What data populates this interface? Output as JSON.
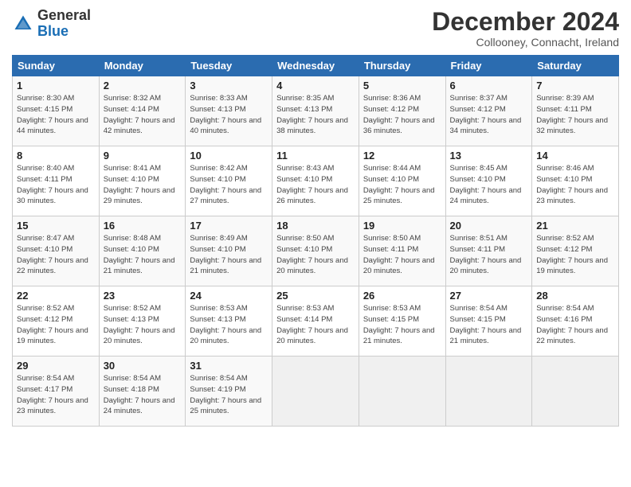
{
  "header": {
    "logo_general": "General",
    "logo_blue": "Blue",
    "month": "December 2024",
    "location": "Collooney, Connacht, Ireland"
  },
  "weekdays": [
    "Sunday",
    "Monday",
    "Tuesday",
    "Wednesday",
    "Thursday",
    "Friday",
    "Saturday"
  ],
  "weeks": [
    [
      {
        "day": "1",
        "sunrise": "Sunrise: 8:30 AM",
        "sunset": "Sunset: 4:15 PM",
        "daylight": "Daylight: 7 hours and 44 minutes."
      },
      {
        "day": "2",
        "sunrise": "Sunrise: 8:32 AM",
        "sunset": "Sunset: 4:14 PM",
        "daylight": "Daylight: 7 hours and 42 minutes."
      },
      {
        "day": "3",
        "sunrise": "Sunrise: 8:33 AM",
        "sunset": "Sunset: 4:13 PM",
        "daylight": "Daylight: 7 hours and 40 minutes."
      },
      {
        "day": "4",
        "sunrise": "Sunrise: 8:35 AM",
        "sunset": "Sunset: 4:13 PM",
        "daylight": "Daylight: 7 hours and 38 minutes."
      },
      {
        "day": "5",
        "sunrise": "Sunrise: 8:36 AM",
        "sunset": "Sunset: 4:12 PM",
        "daylight": "Daylight: 7 hours and 36 minutes."
      },
      {
        "day": "6",
        "sunrise": "Sunrise: 8:37 AM",
        "sunset": "Sunset: 4:12 PM",
        "daylight": "Daylight: 7 hours and 34 minutes."
      },
      {
        "day": "7",
        "sunrise": "Sunrise: 8:39 AM",
        "sunset": "Sunset: 4:11 PM",
        "daylight": "Daylight: 7 hours and 32 minutes."
      }
    ],
    [
      {
        "day": "8",
        "sunrise": "Sunrise: 8:40 AM",
        "sunset": "Sunset: 4:11 PM",
        "daylight": "Daylight: 7 hours and 30 minutes."
      },
      {
        "day": "9",
        "sunrise": "Sunrise: 8:41 AM",
        "sunset": "Sunset: 4:10 PM",
        "daylight": "Daylight: 7 hours and 29 minutes."
      },
      {
        "day": "10",
        "sunrise": "Sunrise: 8:42 AM",
        "sunset": "Sunset: 4:10 PM",
        "daylight": "Daylight: 7 hours and 27 minutes."
      },
      {
        "day": "11",
        "sunrise": "Sunrise: 8:43 AM",
        "sunset": "Sunset: 4:10 PM",
        "daylight": "Daylight: 7 hours and 26 minutes."
      },
      {
        "day": "12",
        "sunrise": "Sunrise: 8:44 AM",
        "sunset": "Sunset: 4:10 PM",
        "daylight": "Daylight: 7 hours and 25 minutes."
      },
      {
        "day": "13",
        "sunrise": "Sunrise: 8:45 AM",
        "sunset": "Sunset: 4:10 PM",
        "daylight": "Daylight: 7 hours and 24 minutes."
      },
      {
        "day": "14",
        "sunrise": "Sunrise: 8:46 AM",
        "sunset": "Sunset: 4:10 PM",
        "daylight": "Daylight: 7 hours and 23 minutes."
      }
    ],
    [
      {
        "day": "15",
        "sunrise": "Sunrise: 8:47 AM",
        "sunset": "Sunset: 4:10 PM",
        "daylight": "Daylight: 7 hours and 22 minutes."
      },
      {
        "day": "16",
        "sunrise": "Sunrise: 8:48 AM",
        "sunset": "Sunset: 4:10 PM",
        "daylight": "Daylight: 7 hours and 21 minutes."
      },
      {
        "day": "17",
        "sunrise": "Sunrise: 8:49 AM",
        "sunset": "Sunset: 4:10 PM",
        "daylight": "Daylight: 7 hours and 21 minutes."
      },
      {
        "day": "18",
        "sunrise": "Sunrise: 8:50 AM",
        "sunset": "Sunset: 4:10 PM",
        "daylight": "Daylight: 7 hours and 20 minutes."
      },
      {
        "day": "19",
        "sunrise": "Sunrise: 8:50 AM",
        "sunset": "Sunset: 4:11 PM",
        "daylight": "Daylight: 7 hours and 20 minutes."
      },
      {
        "day": "20",
        "sunrise": "Sunrise: 8:51 AM",
        "sunset": "Sunset: 4:11 PM",
        "daylight": "Daylight: 7 hours and 20 minutes."
      },
      {
        "day": "21",
        "sunrise": "Sunrise: 8:52 AM",
        "sunset": "Sunset: 4:12 PM",
        "daylight": "Daylight: 7 hours and 19 minutes."
      }
    ],
    [
      {
        "day": "22",
        "sunrise": "Sunrise: 8:52 AM",
        "sunset": "Sunset: 4:12 PM",
        "daylight": "Daylight: 7 hours and 19 minutes."
      },
      {
        "day": "23",
        "sunrise": "Sunrise: 8:52 AM",
        "sunset": "Sunset: 4:13 PM",
        "daylight": "Daylight: 7 hours and 20 minutes."
      },
      {
        "day": "24",
        "sunrise": "Sunrise: 8:53 AM",
        "sunset": "Sunset: 4:13 PM",
        "daylight": "Daylight: 7 hours and 20 minutes."
      },
      {
        "day": "25",
        "sunrise": "Sunrise: 8:53 AM",
        "sunset": "Sunset: 4:14 PM",
        "daylight": "Daylight: 7 hours and 20 minutes."
      },
      {
        "day": "26",
        "sunrise": "Sunrise: 8:53 AM",
        "sunset": "Sunset: 4:15 PM",
        "daylight": "Daylight: 7 hours and 21 minutes."
      },
      {
        "day": "27",
        "sunrise": "Sunrise: 8:54 AM",
        "sunset": "Sunset: 4:15 PM",
        "daylight": "Daylight: 7 hours and 21 minutes."
      },
      {
        "day": "28",
        "sunrise": "Sunrise: 8:54 AM",
        "sunset": "Sunset: 4:16 PM",
        "daylight": "Daylight: 7 hours and 22 minutes."
      }
    ],
    [
      {
        "day": "29",
        "sunrise": "Sunrise: 8:54 AM",
        "sunset": "Sunset: 4:17 PM",
        "daylight": "Daylight: 7 hours and 23 minutes."
      },
      {
        "day": "30",
        "sunrise": "Sunrise: 8:54 AM",
        "sunset": "Sunset: 4:18 PM",
        "daylight": "Daylight: 7 hours and 24 minutes."
      },
      {
        "day": "31",
        "sunrise": "Sunrise: 8:54 AM",
        "sunset": "Sunset: 4:19 PM",
        "daylight": "Daylight: 7 hours and 25 minutes."
      },
      null,
      null,
      null,
      null
    ]
  ]
}
